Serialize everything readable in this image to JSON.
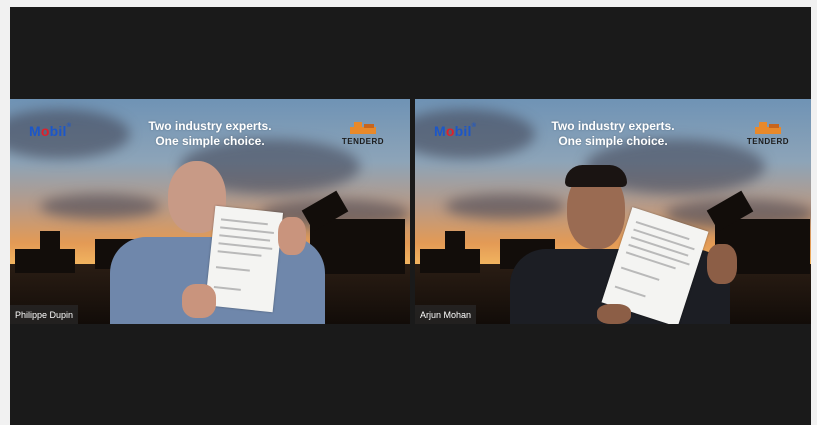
{
  "banner": {
    "brand_left": {
      "m": "M",
      "o": "o",
      "rest": "bil",
      "tm": "®"
    },
    "tagline_line1": "Two industry experts.",
    "tagline_line2": "One simple choice.",
    "brand_right": "TENDERD"
  },
  "participants": [
    {
      "name": "Philippe Dupin"
    },
    {
      "name": "Arjun Mohan"
    }
  ],
  "colors": {
    "background": "#f1f1f1",
    "stage": "#1a1a1a",
    "mobil_blue": "#1c57c9",
    "mobil_red": "#e0202b",
    "tenderd_orange": "#e8892b"
  }
}
